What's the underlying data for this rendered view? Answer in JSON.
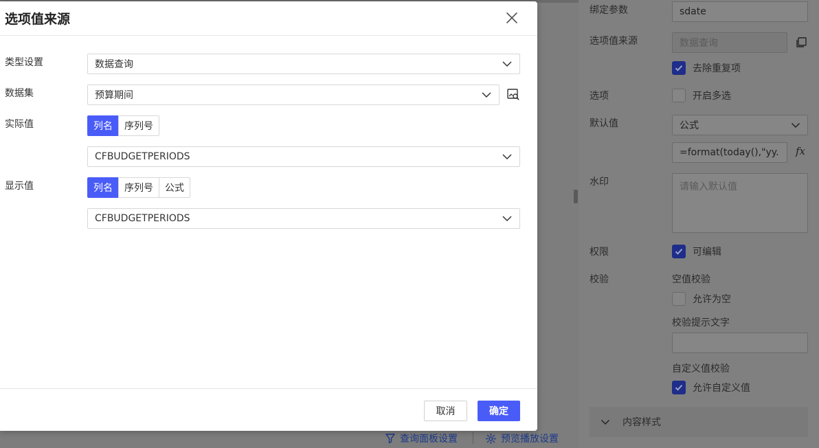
{
  "modal": {
    "title": "选项值来源",
    "type_setting": {
      "label": "类型设置",
      "value": "数据查询"
    },
    "dataset": {
      "label": "数据集",
      "value": "预算期间"
    },
    "actual_value": {
      "label": "实际值",
      "tabs": [
        "列名",
        "序列号"
      ],
      "active_tab": 0,
      "column": "CFBUDGETPERIODS"
    },
    "display_value": {
      "label": "显示值",
      "tabs": [
        "列名",
        "序列号",
        "公式"
      ],
      "active_tab": 0,
      "column": "CFBUDGETPERIODS"
    },
    "cancel_label": "取消",
    "ok_label": "确定"
  },
  "panel": {
    "bind_param": {
      "label": "绑定参数",
      "value": "sdate"
    },
    "option_source": {
      "label": "选项值来源",
      "placeholder": "数据查询"
    },
    "dedupe": {
      "label": "去除重复项",
      "checked": true
    },
    "options": {
      "label": "选项",
      "multi_label": "开启多选",
      "multi_checked": false
    },
    "default_value": {
      "label": "默认值",
      "type": "公式",
      "formula": "=format(today(),\"yy..."
    },
    "formula_icon": "fx",
    "watermark": {
      "label": "水印",
      "placeholder": "请输入默认值"
    },
    "permission": {
      "label": "权限",
      "editable_label": "可编辑",
      "editable_checked": true
    },
    "validation": {
      "label": "校验",
      "empty_title": "空值校验",
      "allow_empty_label": "允许为空",
      "allow_empty_checked": false,
      "hint_title": "校验提示文字",
      "custom_title": "自定义值校验",
      "allow_custom_label": "允许自定义值",
      "allow_custom_checked": true
    },
    "content_style": {
      "label": "内容样式"
    }
  },
  "bottom_bar": {
    "query_panel_settings": "查询面板设置",
    "preview_play_settings": "预览播放设置"
  },
  "colors": {
    "accent": "#4a5cf7"
  }
}
